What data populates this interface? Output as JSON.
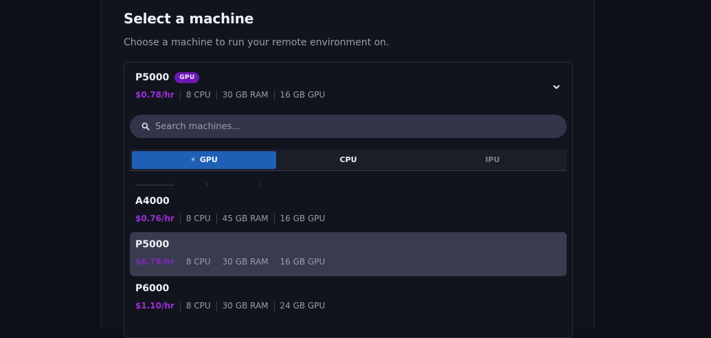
{
  "header": {
    "title": "Select a machine",
    "subtitle": "Choose a machine to run your remote environment on."
  },
  "selected": {
    "name": "P5000",
    "badge": "GPU",
    "price": "$0.78/hr",
    "cpu": "8 CPU",
    "ram": "30 GB RAM",
    "gpu": "16 GB GPU"
  },
  "search": {
    "placeholder": "Search machines...",
    "value": ""
  },
  "tabs": [
    {
      "label": "GPU",
      "icon": "lightning-icon",
      "state": "active"
    },
    {
      "label": "CPU",
      "state": "normal"
    },
    {
      "label": "IPU",
      "state": "disabled"
    }
  ],
  "machines": [
    {
      "name": "A4000",
      "price": "$0.76/hr",
      "cpu": "8 CPU",
      "ram": "45 GB RAM",
      "gpu": "16 GB GPU"
    },
    {
      "name": "P5000",
      "price": "$0.78/hr",
      "cpu": "8 CPU",
      "ram": "30 GB RAM",
      "gpu": "16 GB GPU"
    },
    {
      "name": "P6000",
      "price": "$1.10/hr",
      "cpu": "8 CPU",
      "ram": "30 GB RAM",
      "gpu": "24 GB GPU"
    }
  ],
  "colors": {
    "accent": "#1f5fb4",
    "price": "#9b30d9",
    "badge": "#6a1ab3"
  }
}
